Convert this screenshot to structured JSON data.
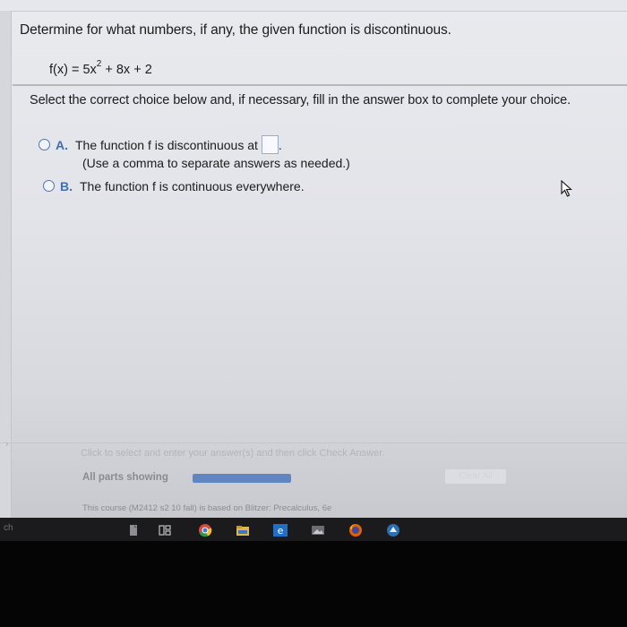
{
  "question": {
    "text": "Determine for what numbers, if any, the given function is discontinuous.",
    "function_prefix": "f(x) = 5x",
    "function_exponent": "2",
    "function_suffix": " + 8x + 2"
  },
  "instruction": "Select the correct choice below and, if necessary, fill in the answer box to complete your choice.",
  "choices": [
    {
      "letter": "A.",
      "text": "The function f is discontinuous at",
      "answer_value": "",
      "hint": "(Use a comma to separate answers as needed.)"
    },
    {
      "letter": "B.",
      "text": "The function f is continuous everywhere."
    }
  ],
  "footer": {
    "hint": "Click to select and enter your answer(s) and then click Check Answer.",
    "parts_label": "All parts showing",
    "progress": 1.0,
    "clear_all": "Clear All",
    "course_note": "This course (M2412 s2 10 fall) is based on Blitzer: Precalculus, 6e"
  },
  "taskbar": {
    "left_label": "ch",
    "icons": [
      "file-icon",
      "task-view-icon",
      "chrome-icon",
      "file-explorer-icon",
      "edge-icon",
      "photos-icon",
      "firefox-icon",
      "app-icon"
    ]
  },
  "colors": {
    "accent": "#3e6fb3",
    "progress_fill": "#5f86c0"
  }
}
